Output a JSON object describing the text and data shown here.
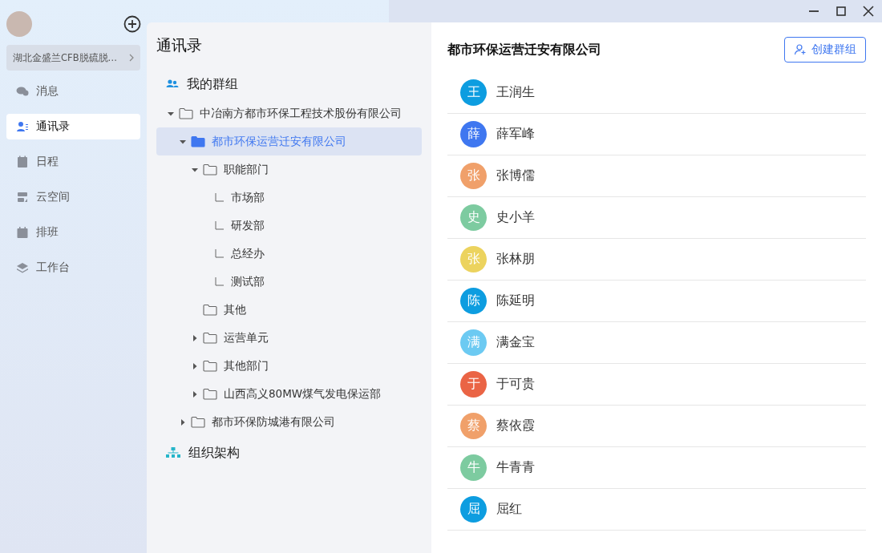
{
  "sidebar": {
    "org": "湖北金盛兰CFB脱硫脱…",
    "items": [
      {
        "label": "消息",
        "kind": "chat",
        "selected": false
      },
      {
        "label": "通讯录",
        "kind": "contacts",
        "selected": true
      },
      {
        "label": "日程",
        "kind": "calendar",
        "selected": false
      },
      {
        "label": "云空间",
        "kind": "cloud",
        "selected": false
      },
      {
        "label": "排班",
        "kind": "schedule",
        "selected": false
      },
      {
        "label": "工作台",
        "kind": "layers",
        "selected": false
      }
    ]
  },
  "directory": {
    "title": "通讯录",
    "groups_label": "我的群组",
    "org_label": "组织架构",
    "tree": [
      {
        "label": "中冶南方都市环保工程技术股份有限公司",
        "kind": "group",
        "expanded": true,
        "selected": false,
        "children": [
          {
            "label": "都市环保运营迁安有限公司",
            "kind": "group",
            "expanded": true,
            "selected": true,
            "children": [
              {
                "label": "职能部门",
                "kind": "group",
                "expanded": true,
                "selected": false,
                "children": [
                  {
                    "label": "市场部",
                    "kind": "leaf",
                    "selected": false
                  },
                  {
                    "label": "研发部",
                    "kind": "leaf",
                    "selected": false
                  },
                  {
                    "label": "总经办",
                    "kind": "leaf",
                    "selected": false
                  },
                  {
                    "label": "测试部",
                    "kind": "leaf",
                    "selected": false
                  }
                ]
              },
              {
                "label": "其他",
                "kind": "folder",
                "selected": false
              },
              {
                "label": "运营单元",
                "kind": "group",
                "expanded": false,
                "selected": false
              },
              {
                "label": "其他部门",
                "kind": "group",
                "expanded": false,
                "selected": false
              },
              {
                "label": "山西高义80MW煤气发电保运部",
                "kind": "group",
                "expanded": false,
                "selected": false
              }
            ]
          },
          {
            "label": "都市环保防城港有限公司",
            "kind": "group",
            "expanded": false,
            "selected": false
          }
        ]
      }
    ]
  },
  "members": {
    "title": "都市环保运营迁安有限公司",
    "create_button": "创建群组",
    "list": [
      {
        "initial": "王",
        "name": "王润生",
        "color": "#0d9de0"
      },
      {
        "initial": "薛",
        "name": "薛军峰",
        "color": "#3f77f0"
      },
      {
        "initial": "张",
        "name": "张博儒",
        "color": "#f0a06a"
      },
      {
        "initial": "史",
        "name": "史小羊",
        "color": "#7dcba0"
      },
      {
        "initial": "张",
        "name": "张林朋",
        "color": "#ecd35e"
      },
      {
        "initial": "陈",
        "name": "陈延明",
        "color": "#0d9de0"
      },
      {
        "initial": "满",
        "name": "满金宝",
        "color": "#6ccaf2"
      },
      {
        "initial": "于",
        "name": "于可贵",
        "color": "#ea6445"
      },
      {
        "initial": "蔡",
        "name": "蔡依霞",
        "color": "#f0a06a"
      },
      {
        "initial": "牛",
        "name": "牛青青",
        "color": "#7dcba0"
      },
      {
        "initial": "屈",
        "name": "屈红",
        "color": "#0d9de0"
      }
    ]
  }
}
